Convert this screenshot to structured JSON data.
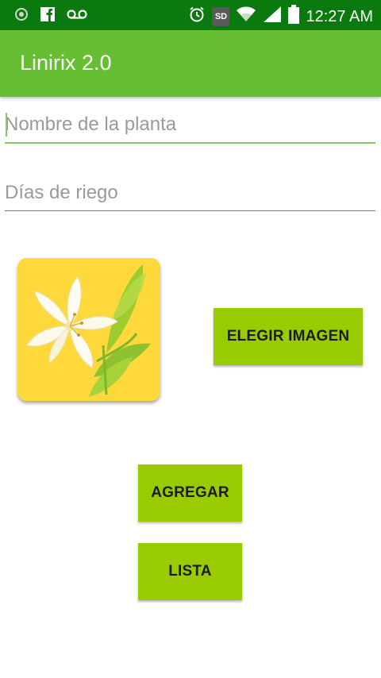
{
  "status_bar": {
    "time": "12:27 AM",
    "sd_label": "SD",
    "icons": [
      "record-icon",
      "facebook-icon",
      "voicemail-icon",
      "alarm-icon",
      "sd-card-icon",
      "wifi-icon",
      "cellular-signal-icon",
      "battery-icon"
    ]
  },
  "app_bar": {
    "title": "Linirix 2.0",
    "color": "#66bf32"
  },
  "form": {
    "plant_name_placeholder": "Nombre de la planta",
    "plant_name_value": "",
    "watering_days_placeholder": "Días de riego",
    "watering_days_value": ""
  },
  "image": {
    "subject": "lily-flower-icon"
  },
  "buttons": {
    "choose_image": "ELEGIR IMAGEN",
    "add": "AGREGAR",
    "list": "LISTA",
    "color": "#99cc00"
  }
}
